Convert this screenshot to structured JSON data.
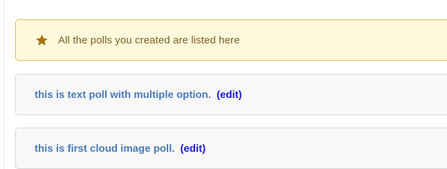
{
  "notice": {
    "icon": "star-icon",
    "icon_color": "#a7720b",
    "text": "All the polls you created are listed here"
  },
  "polls": [
    {
      "title": "this is text poll with multiple option.",
      "edit_label": "(edit)"
    },
    {
      "title": "this is first cloud image poll.",
      "edit_label": "(edit)"
    }
  ],
  "colors": {
    "notice_bg": "#fff8dc",
    "notice_border": "#d9b866",
    "poll_title": "#4a7ab8",
    "edit_link": "#1a1ad9"
  }
}
